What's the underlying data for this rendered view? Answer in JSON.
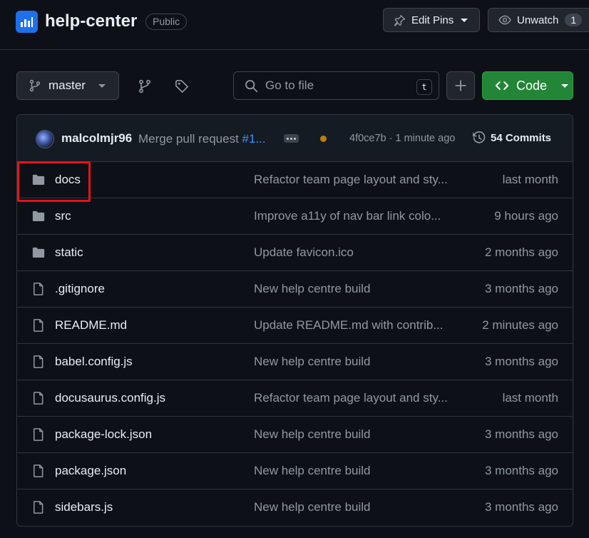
{
  "repo": {
    "name": "help-center",
    "visibility": "Public"
  },
  "actions": {
    "edit_pins": "Edit Pins",
    "unwatch": "Unwatch",
    "watch_count": "1"
  },
  "toolbar": {
    "branch": "master",
    "goto_placeholder": "Go to file",
    "goto_shortcut": "t",
    "code_label": "Code"
  },
  "latest_commit": {
    "author": "malcolmjr96",
    "message": "Merge pull request ",
    "pr_ref": "#1...",
    "sha_time": "4f0ce7b · 1 minute ago",
    "commits_count": "54 Commits"
  },
  "files": [
    {
      "type": "folder",
      "name": "docs",
      "message": "Refactor team page layout and sty...",
      "time": "last month"
    },
    {
      "type": "folder",
      "name": "src",
      "message": "Improve a11y of nav bar link colo...",
      "time": "9 hours ago"
    },
    {
      "type": "folder",
      "name": "static",
      "message": "Update favicon.ico",
      "time": "2 months ago"
    },
    {
      "type": "file",
      "name": ".gitignore",
      "message": "New help centre build",
      "time": "3 months ago"
    },
    {
      "type": "file",
      "name": "README.md",
      "message": "Update README.md with contrib...",
      "time": "2 minutes ago"
    },
    {
      "type": "file",
      "name": "babel.config.js",
      "message": "New help centre build",
      "time": "3 months ago"
    },
    {
      "type": "file",
      "name": "docusaurus.config.js",
      "message": "Refactor team page layout and sty...",
      "time": "last month"
    },
    {
      "type": "file",
      "name": "package-lock.json",
      "message": "New help centre build",
      "time": "3 months ago"
    },
    {
      "type": "file",
      "name": "package.json",
      "message": "New help centre build",
      "time": "3 months ago"
    },
    {
      "type": "file",
      "name": "sidebars.js",
      "message": "New help centre build",
      "time": "3 months ago"
    }
  ],
  "colors": {
    "background": "#0d1117",
    "accent_green": "#238636",
    "link_blue": "#4493f8",
    "highlight_red": "#e8101a",
    "status_pending": "#bb8009"
  }
}
